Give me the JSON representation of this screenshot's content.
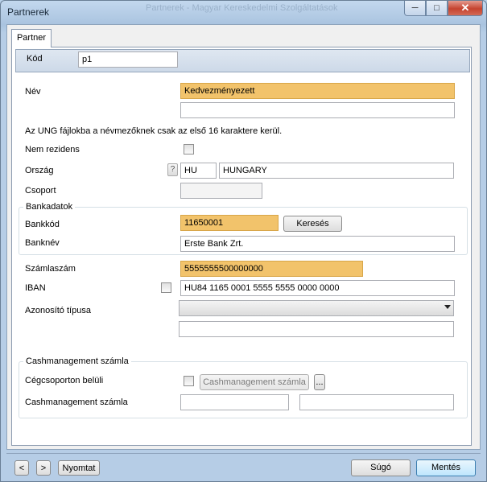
{
  "window": {
    "title": "Partnerek",
    "background_title": "Partnerek - Magyar Kereskedelmi Szolgáltatások"
  },
  "caption_buttons": {
    "minimize": "─",
    "maximize": "□",
    "close": "✕"
  },
  "tab": {
    "label": "Partner"
  },
  "header": {
    "kod_label": "Kód",
    "kod_value": "p1"
  },
  "form": {
    "nev_label": "Név",
    "nev_value": "Kedvezményezett",
    "nev2_value": "",
    "note": "Az UNG fájlokba a névmezőknek csak az első 16 karaktere kerül.",
    "nem_rezidens_label": "Nem rezidens",
    "orszag_label": "Ország",
    "orszag_help": "?",
    "orszag_code": "HU",
    "orszag_name": "HUNGARY",
    "csoport_label": "Csoport",
    "csoport_value": ""
  },
  "bank": {
    "group_title": "Bankadatok",
    "bankkod_label": "Bankkód",
    "bankkod_value": "11650001",
    "search_button": "Keresés",
    "banknev_label": "Banknév",
    "banknev_value": "Erste Bank Zrt."
  },
  "account": {
    "szamlaszam_label": "Számlaszám",
    "szamlaszam_value": "5555555500000000",
    "iban_label": "IBAN",
    "iban_value": "HU84 1165 0001 5555 5555 0000 0000",
    "azonosito_label": "Azonosító típusa",
    "azonosito_value": "",
    "azonosito2_value": ""
  },
  "cash": {
    "group_title": "Cashmanagement számla",
    "cegcsoport_label": "Cégcsoporton belüli",
    "cash_button": "Cashmanagement számla",
    "ellipsis_button": "...",
    "cash_label": "Cashmanagement számla",
    "cash_value1": "",
    "cash_value2": ""
  },
  "footer": {
    "prev": "<",
    "next": ">",
    "print": "Nyomtat",
    "help": "Súgó",
    "save": "Mentés"
  },
  "colors": {
    "required_field": "#f2c36b",
    "header_strip": "#cdd9e8",
    "window_frame": "#b9d1ea"
  }
}
